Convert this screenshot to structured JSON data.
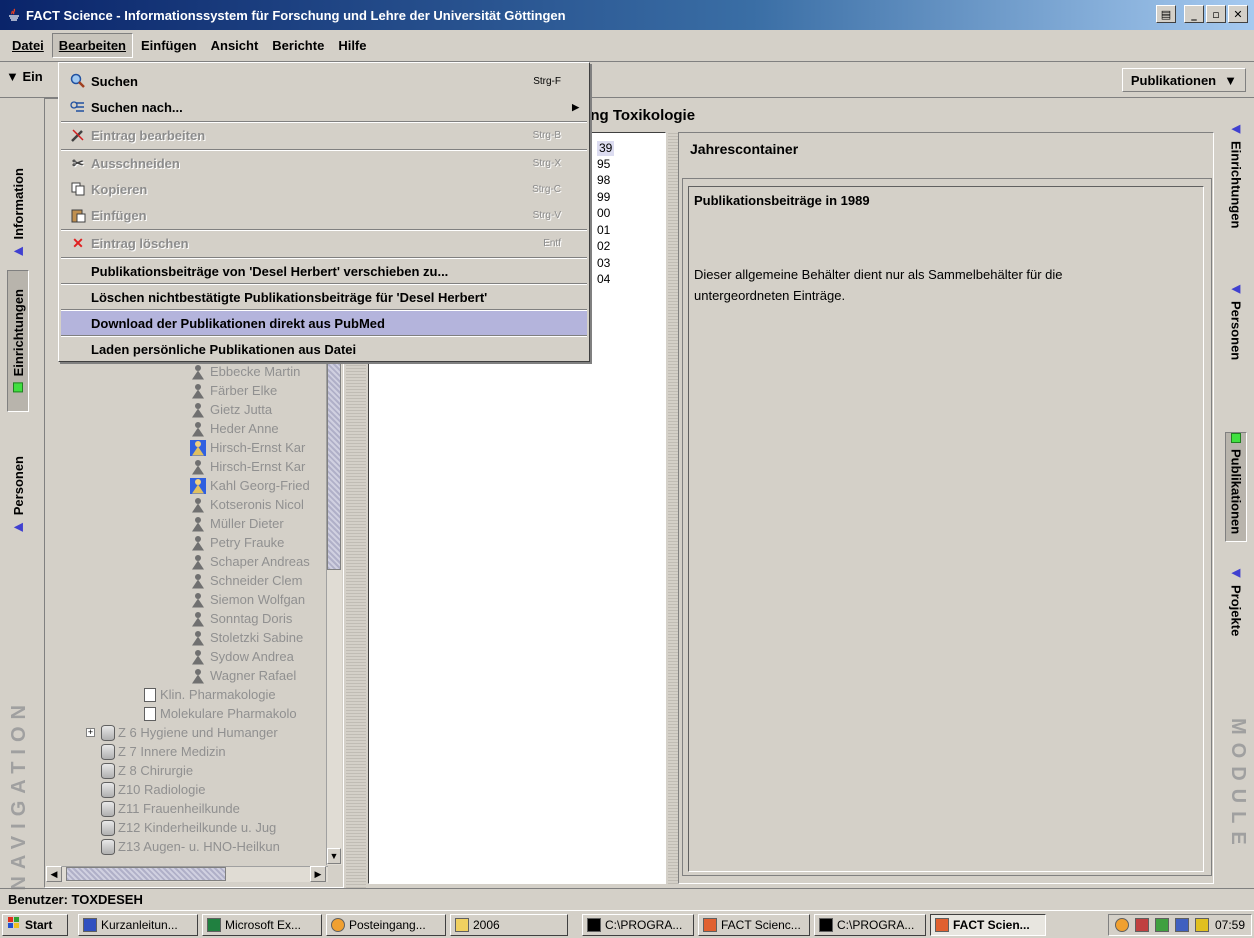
{
  "window": {
    "title": "FACT Science - Informationssystem für Forschung und Lehre der Universität Göttingen"
  },
  "menubar": {
    "items": [
      "Datei",
      "Bearbeiten",
      "Einfügen",
      "Ansicht",
      "Berichte",
      "Hilfe"
    ]
  },
  "toolbar": {
    "left_label": "Ein",
    "module_select": "Publikationen"
  },
  "edit_menu": {
    "items": [
      {
        "label": "Suchen",
        "shortcut": "Strg-F"
      },
      {
        "label": "Suchen nach..."
      },
      {
        "label": "Eintrag bearbeiten",
        "shortcut": "Strg-B"
      },
      {
        "label": "Ausschneiden",
        "shortcut": "Strg-X"
      },
      {
        "label": "Kopieren",
        "shortcut": "Strg-C"
      },
      {
        "label": "Einfügen",
        "shortcut": "Strg-V"
      },
      {
        "label": "Eintrag löschen",
        "shortcut": "Entf"
      },
      {
        "label": "Publikationsbeiträge von 'Desel Herbert' verschieben zu..."
      },
      {
        "label": "Löschen nichtbestätigte Publikationsbeiträge für 'Desel Herbert'"
      },
      {
        "label": "Download der Publikationen direkt aus PubMed"
      },
      {
        "label": "Laden persönliche Publikationen aus Datei"
      }
    ]
  },
  "navigation": {
    "label": "NAVIGATION",
    "tabs": [
      "Information",
      "Einrichtungen",
      "Personen"
    ]
  },
  "modules": {
    "label": "MODULE",
    "tabs": [
      "Einrichtungen",
      "Personen",
      "Publikationen",
      "Projekte"
    ]
  },
  "tree": {
    "persons": [
      "Ebbecke Martin",
      "Färber Elke",
      "Gietz Jutta",
      "Heder Anne",
      "Hirsch-Ernst Kar",
      "Hirsch-Ernst Kar",
      "Kahl Georg-Fried",
      "Kotseronis Nicol",
      "Müller Dieter",
      "Petry Frauke",
      "Schaper Andreas",
      "Schneider Clem",
      "Siemon Wolfgan",
      "Sonntag Doris",
      "Stoletzki Sabine",
      "Sydow Andrea",
      "Wagner Rafael"
    ],
    "subunits": [
      "Klin. Pharmakologie",
      "Molekulare Pharmakolo"
    ],
    "departments": [
      "Z 6 Hygiene und Humanger",
      "Z 7 Innere Medizin",
      "Z 8 Chirurgie",
      "Z10 Radiologie",
      "Z11 Frauenheilkunde",
      "Z12 Kinderheilkunde u. Jug",
      "Z13 Augen- u. HNO-Heilkun"
    ]
  },
  "main": {
    "header": "ngsmitglied in der Einrichtung Toxikologie",
    "years": [
      "39",
      "95",
      "98",
      "99",
      "00",
      "01",
      "02",
      "03",
      "04"
    ],
    "container_title": "Jahrescontainer",
    "section_title": "Publikationsbeiträge in 1989",
    "description": "Dieser allgemeine Behälter dient nur als Sammelbehälter für die untergeordneten Einträge."
  },
  "status": {
    "user": "Benutzer: TOXDESEH"
  },
  "taskbar": {
    "start": "Start",
    "tasks": [
      "Kurzanleitun...",
      "Microsoft Ex...",
      "Posteingang...",
      "2006",
      "C:\\PROGRA...",
      "FACT Scienc...",
      "C:\\PROGRA...",
      "FACT Scien..."
    ],
    "clock": "07:59"
  },
  "colors": {
    "accent_menu_highlight": "#b4b4dc",
    "title_gradient_start": "#0a246a",
    "nav_triangle": "#4040d0",
    "active_square": "#40e040"
  }
}
